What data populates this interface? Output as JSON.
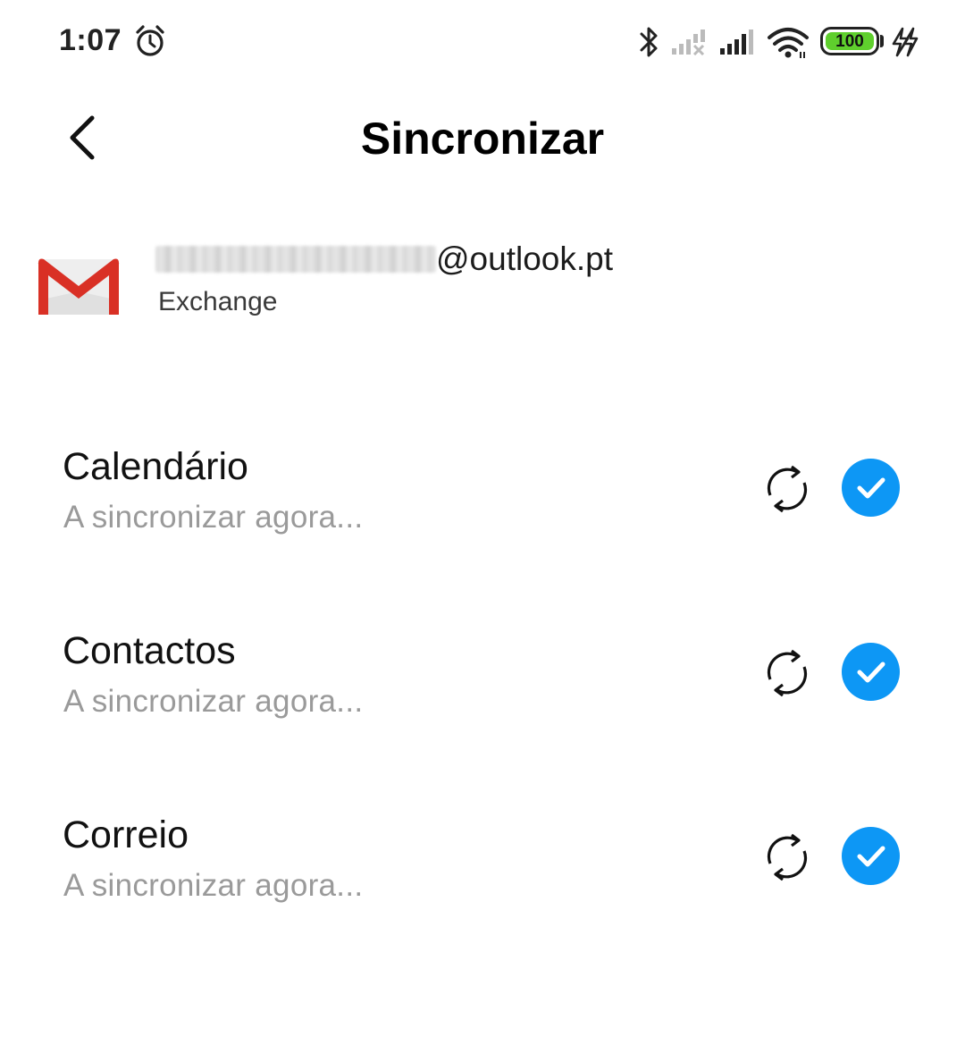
{
  "status_bar": {
    "time": "1:07",
    "battery_level": "100",
    "icons": [
      "alarm-icon",
      "bluetooth-icon",
      "signal-no-service-icon",
      "signal-icon",
      "wifi-icon",
      "battery-icon",
      "charging-icon"
    ]
  },
  "header": {
    "title": "Sincronizar",
    "back_icon": "chevron-left-icon"
  },
  "account": {
    "email_visible": "@outlook.pt",
    "type": "Exchange",
    "logo_icon": "gmail-icon"
  },
  "sync_items": [
    {
      "title": "Calendário",
      "status": "A sincronizar agora...",
      "checked": true
    },
    {
      "title": "Contactos",
      "status": "A sincronizar agora...",
      "checked": true
    },
    {
      "title": "Correio",
      "status": "A sincronizar agora...",
      "checked": true
    }
  ],
  "colors": {
    "accent": "#0d97f5",
    "battery_fill": "#5fcf2d",
    "secondary_text": "#9a9a9a",
    "gmail_red": "#d93025"
  }
}
